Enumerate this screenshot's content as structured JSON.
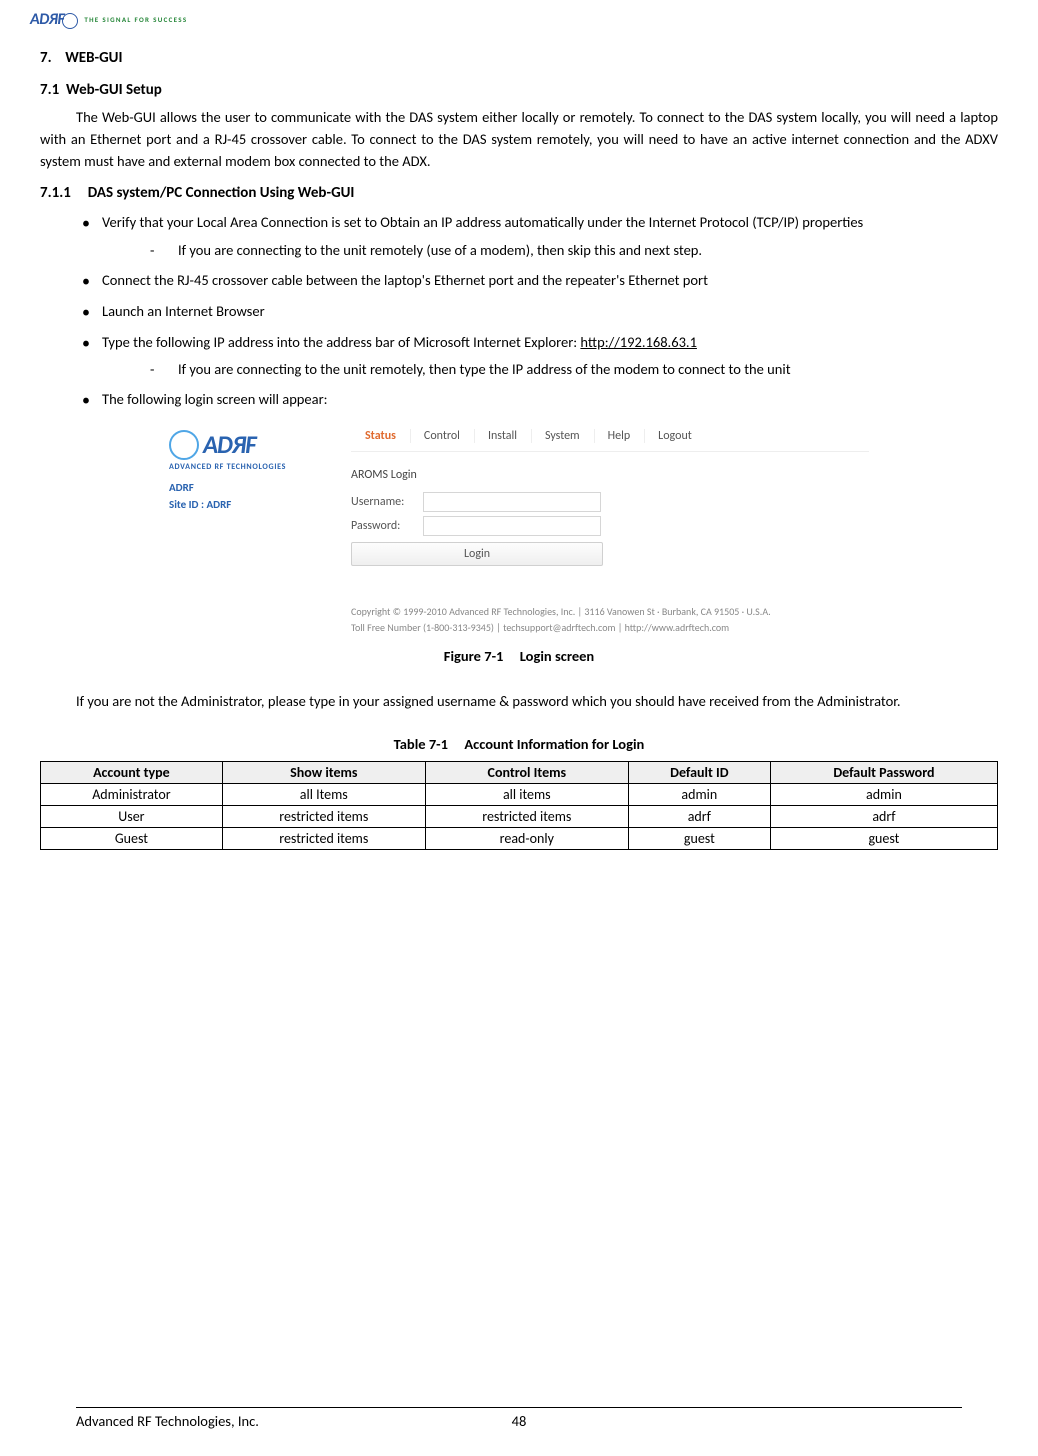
{
  "header": {
    "logo_text": "ADЯF",
    "tagline": "THE SIGNAL FOR SUCCESS"
  },
  "sections": {
    "h1_num": "7.",
    "h1_title": "WEB-GUI",
    "h2_num": "7.1",
    "h2_title": "Web-GUI Setup",
    "intro": "The Web-GUI allows the user to communicate with the DAS system either locally or remotely.  To connect to the DAS system locally, you will need a laptop with an Ethernet port and a RJ-45 crossover cable.  To connect to the DAS system remotely, you will need to have an active internet connection and the ADXV system must have and external modem box connected to the ADX.",
    "h3_num": "7.1.1",
    "h3_title": "DAS system/PC Connection Using Web-GUI",
    "bul1": "Verify that your Local Area Connection is set to Obtain an IP address automatically under the Internet Protocol (TCP/IP) properties",
    "bul1_sub": "If you are connecting to the unit remotely (use of a modem), then skip this and next step.",
    "bul2": "Connect the RJ-45 crossover cable between the laptop's Ethernet port and the repeater's Ethernet port",
    "bul3": "Launch an Internet Browser",
    "bul4_pre": "Type the following IP address into the address bar of Microsoft Internet Explorer: ",
    "bul4_url": "http://192.168.63.1",
    "bul4_sub": "If you are connecting to the unit remotely, then type the IP address of the modem to connect to the unit",
    "bul5": "The following login screen will appear:",
    "fig_label": "Figure 7-1",
    "fig_title": "Login screen",
    "post_fig": "If you are not the Administrator, please type in your assigned username & password which you should have received from the Administrator.",
    "table_label": "Table 7-1",
    "table_title": "Account Information for Login"
  },
  "login_shot": {
    "brand": "ADЯF",
    "brand_sub": "ADVANCED RF TECHNOLOGIES",
    "meta_line1": "ADRF",
    "meta_line2": "Site ID : ADRF",
    "tabs": [
      "Status",
      "Control",
      "Install",
      "System",
      "Help",
      "Logout"
    ],
    "login_title": "AROMS Login",
    "username_label": "Username:",
    "password_label": "Password:",
    "login_btn": "Login",
    "copyright1": "Copyright © 1999-2010 Advanced RF Technologies, Inc. | 3116 Vanowen St · Burbank, CA 91505 · U.S.A.",
    "copyright2": "Toll Free Number (1-800-313-9345) | techsupport@adrftech.com | http://www.adrftech.com"
  },
  "table": {
    "headers": [
      "Account type",
      "Show items",
      "Control Items",
      "Default ID",
      "Default Password"
    ],
    "rows": [
      [
        "Administrator",
        "all Items",
        "all items",
        "admin",
        "admin"
      ],
      [
        "User",
        "restricted items",
        "restricted items",
        "adrf",
        "adrf"
      ],
      [
        "Guest",
        "restricted items",
        "read-only",
        "guest",
        "guest"
      ]
    ]
  },
  "footer": {
    "company": "Advanced RF Technologies, Inc.",
    "page": "48"
  }
}
